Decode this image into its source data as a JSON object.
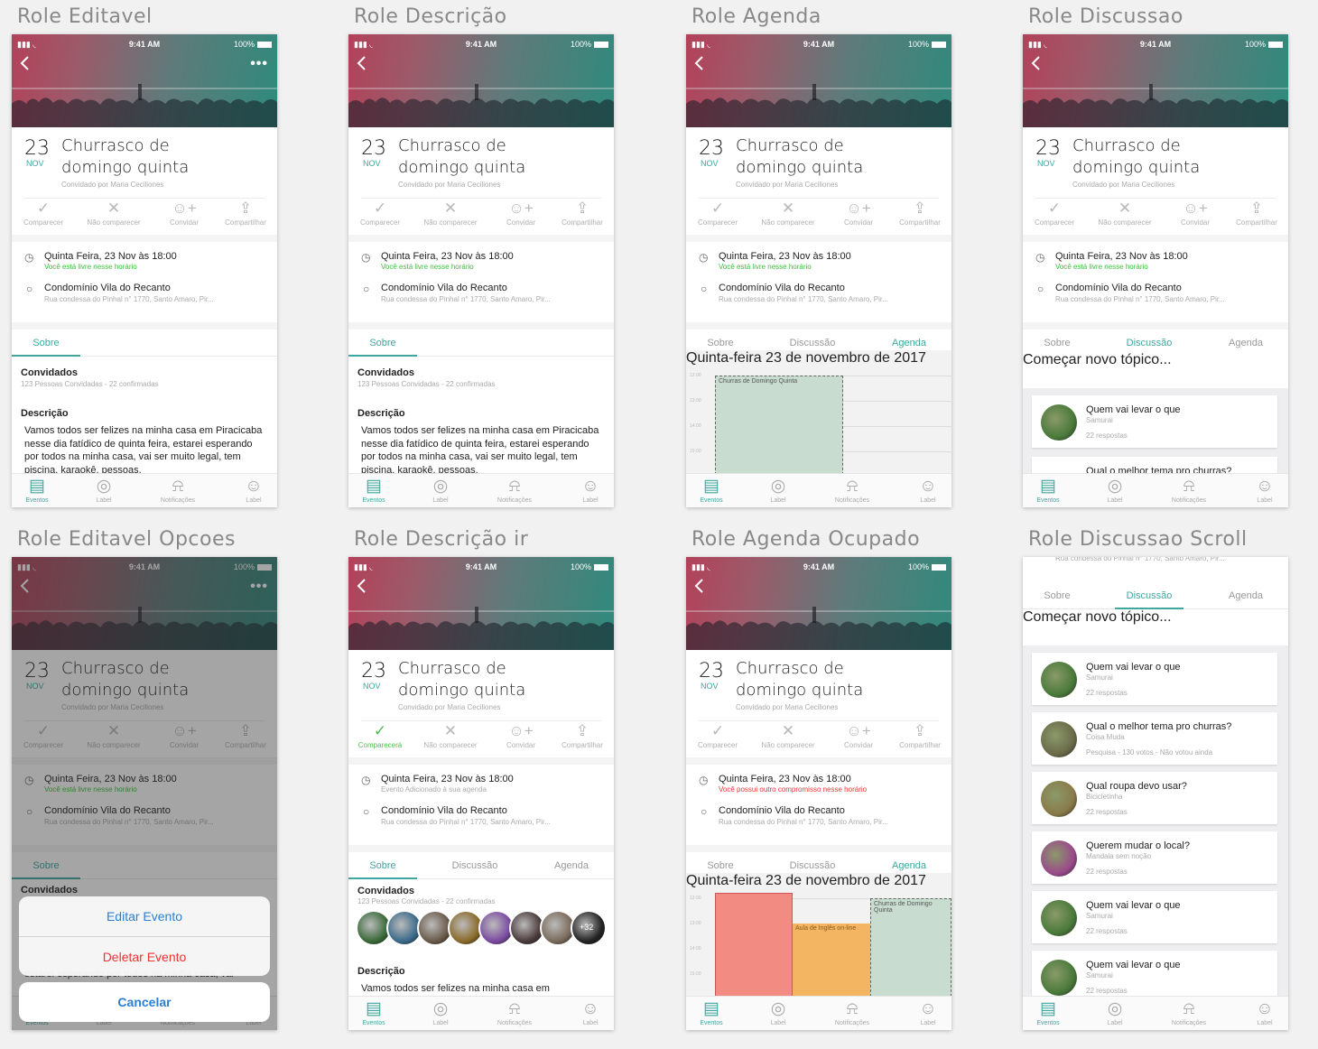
{
  "boards": [
    {
      "title": "Role Editavel"
    },
    {
      "title": "Role Descrição"
    },
    {
      "title": "Role Agenda"
    },
    {
      "title": "Role Discussao"
    },
    {
      "title": "Role Editavel Opcoes"
    },
    {
      "title": "Role Descrição ir"
    },
    {
      "title": "Role Agenda Ocupado"
    },
    {
      "title": "Role Discussao Scroll"
    }
  ],
  "status_bar": {
    "time": "9:41 AM",
    "battery": "100%"
  },
  "event": {
    "day": "23",
    "month": "NOV",
    "title_line1": "Churrasco de",
    "title_line2": "domingo quinta",
    "invited_by": "Convidado por Maria Ceciliones",
    "datetime": "Quinta Feira, 23 Nov às 18:00",
    "free_notice": "Você está livre nesse horário",
    "added_notice": "Evento Adicionado à sua agenda",
    "busy_notice": "Você possui outro compromisso nesse horário",
    "place": "Condomínio Vila do Recanto",
    "address": "Rua condessa do Pinhal n° 1770, Santo Amaro, Pir..."
  },
  "actions": {
    "attend": "Comparecer",
    "attending": "Comparecerá",
    "not_attend": "Não comparecer",
    "invite": "Convidar",
    "share": "Compartilhar"
  },
  "tabs": {
    "about": "Sobre",
    "discussion": "Discussão",
    "agenda": "Agenda"
  },
  "about": {
    "guests_title": "Convidados",
    "guests_sub": "123 Pessoas Convidadas - 22 confirmadas",
    "desc_title": "Descrição",
    "desc_text": "Vamos todos ser felizes na minha casa em Piracicaba nesse dia fatídico de quinta feira, estarei esperando por todos na minha casa, vai ser muito legal, tem piscina, karaokê, pessoas.",
    "desc_first_line": "Vamos todos ser felizes na minha casa em",
    "more_count": "+32",
    "overlay_desc_text": "estarei esperando por todos na minha casa, vai"
  },
  "agenda": {
    "date_header": "Quinta-feira 23 de novembro de 2017",
    "hours": [
      "12:00",
      "13:00",
      "14:00",
      "15:00"
    ],
    "event_label": "Churras de Domingo Quinta",
    "busy_event_label": "Aula de Inglês on-line",
    "busy_event_label2": "Churras de Domingo Quinta"
  },
  "discussion": {
    "new_topic_placeholder": "Começar novo tópico...",
    "topics": [
      {
        "title": "Quem vai levar o que",
        "author": "Samurai",
        "meta": "22 respostas",
        "color": "#4a7a3a"
      },
      {
        "title": "Qual o melhor tema pro churras?",
        "author": "Coisa Muda",
        "meta": "Pesquisa - 130 votos - Não votou ainda",
        "color": "#6b6b4a"
      },
      {
        "title": "Qual roupa devo usar?",
        "author": "Bicicletinha",
        "meta": "22 respostas",
        "color": "#8a7a4a"
      },
      {
        "title": "Querem mudar o local?",
        "author": "Mandala sem noção",
        "meta": "22 respostas",
        "color": "#9a4a8a"
      },
      {
        "title": "Quem vai levar o que",
        "author": "Samurai",
        "meta": "22 respostas",
        "color": "#4a7a3a"
      },
      {
        "title": "Quem vai levar o que",
        "author": "Samurai",
        "meta": "22 respostas",
        "color": "#4a7a3a"
      }
    ],
    "partial_topic_title": "Qual o melhor tema pro churras?",
    "partial_address": "Rua condessa do Pinhal n° 1770, Santo Amaro, Pir..."
  },
  "sheet": {
    "edit": "Editar Evento",
    "delete": "Deletar Evento",
    "cancel": "Cancelar"
  },
  "tabbar": {
    "events": "Eventos",
    "label": "Label",
    "notifications": "Notificações",
    "profile": "Label"
  },
  "colors": {
    "accent": "#3fa6a0",
    "green": "#4cbf4c",
    "red": "#e33",
    "busy_red": "#f28b82",
    "busy_orange": "#f3b562",
    "agenda_green": "#c8ddd0"
  }
}
